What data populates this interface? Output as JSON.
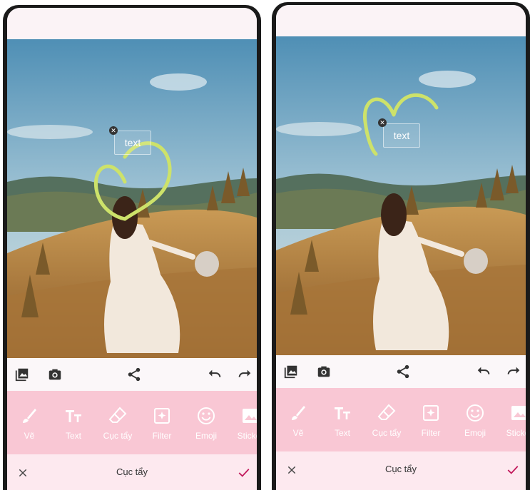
{
  "canvas_text": "text",
  "toolbar": {
    "tools": [
      {
        "label": "Vẽ",
        "icon": "brush-icon"
      },
      {
        "label": "Text",
        "icon": "text-icon"
      },
      {
        "label": "Cục tẩy",
        "icon": "eraser-icon"
      },
      {
        "label": "Filter",
        "icon": "filter-icon"
      },
      {
        "label": "Emoji",
        "icon": "emoji-icon"
      },
      {
        "label": "Sticker",
        "icon": "sticker-icon"
      }
    ]
  },
  "bottom_bar": {
    "title": "Cục tẩy"
  },
  "colors": {
    "tool_bar_bg": "#f9c7d4",
    "bottom_bar_bg": "#fde9ef",
    "stroke": "#cde26a",
    "confirm": "#c2185b"
  },
  "icons": [
    "gallery-icon",
    "camera-icon",
    "share-icon",
    "undo-icon",
    "redo-icon",
    "close-icon",
    "checkmark-icon"
  ]
}
